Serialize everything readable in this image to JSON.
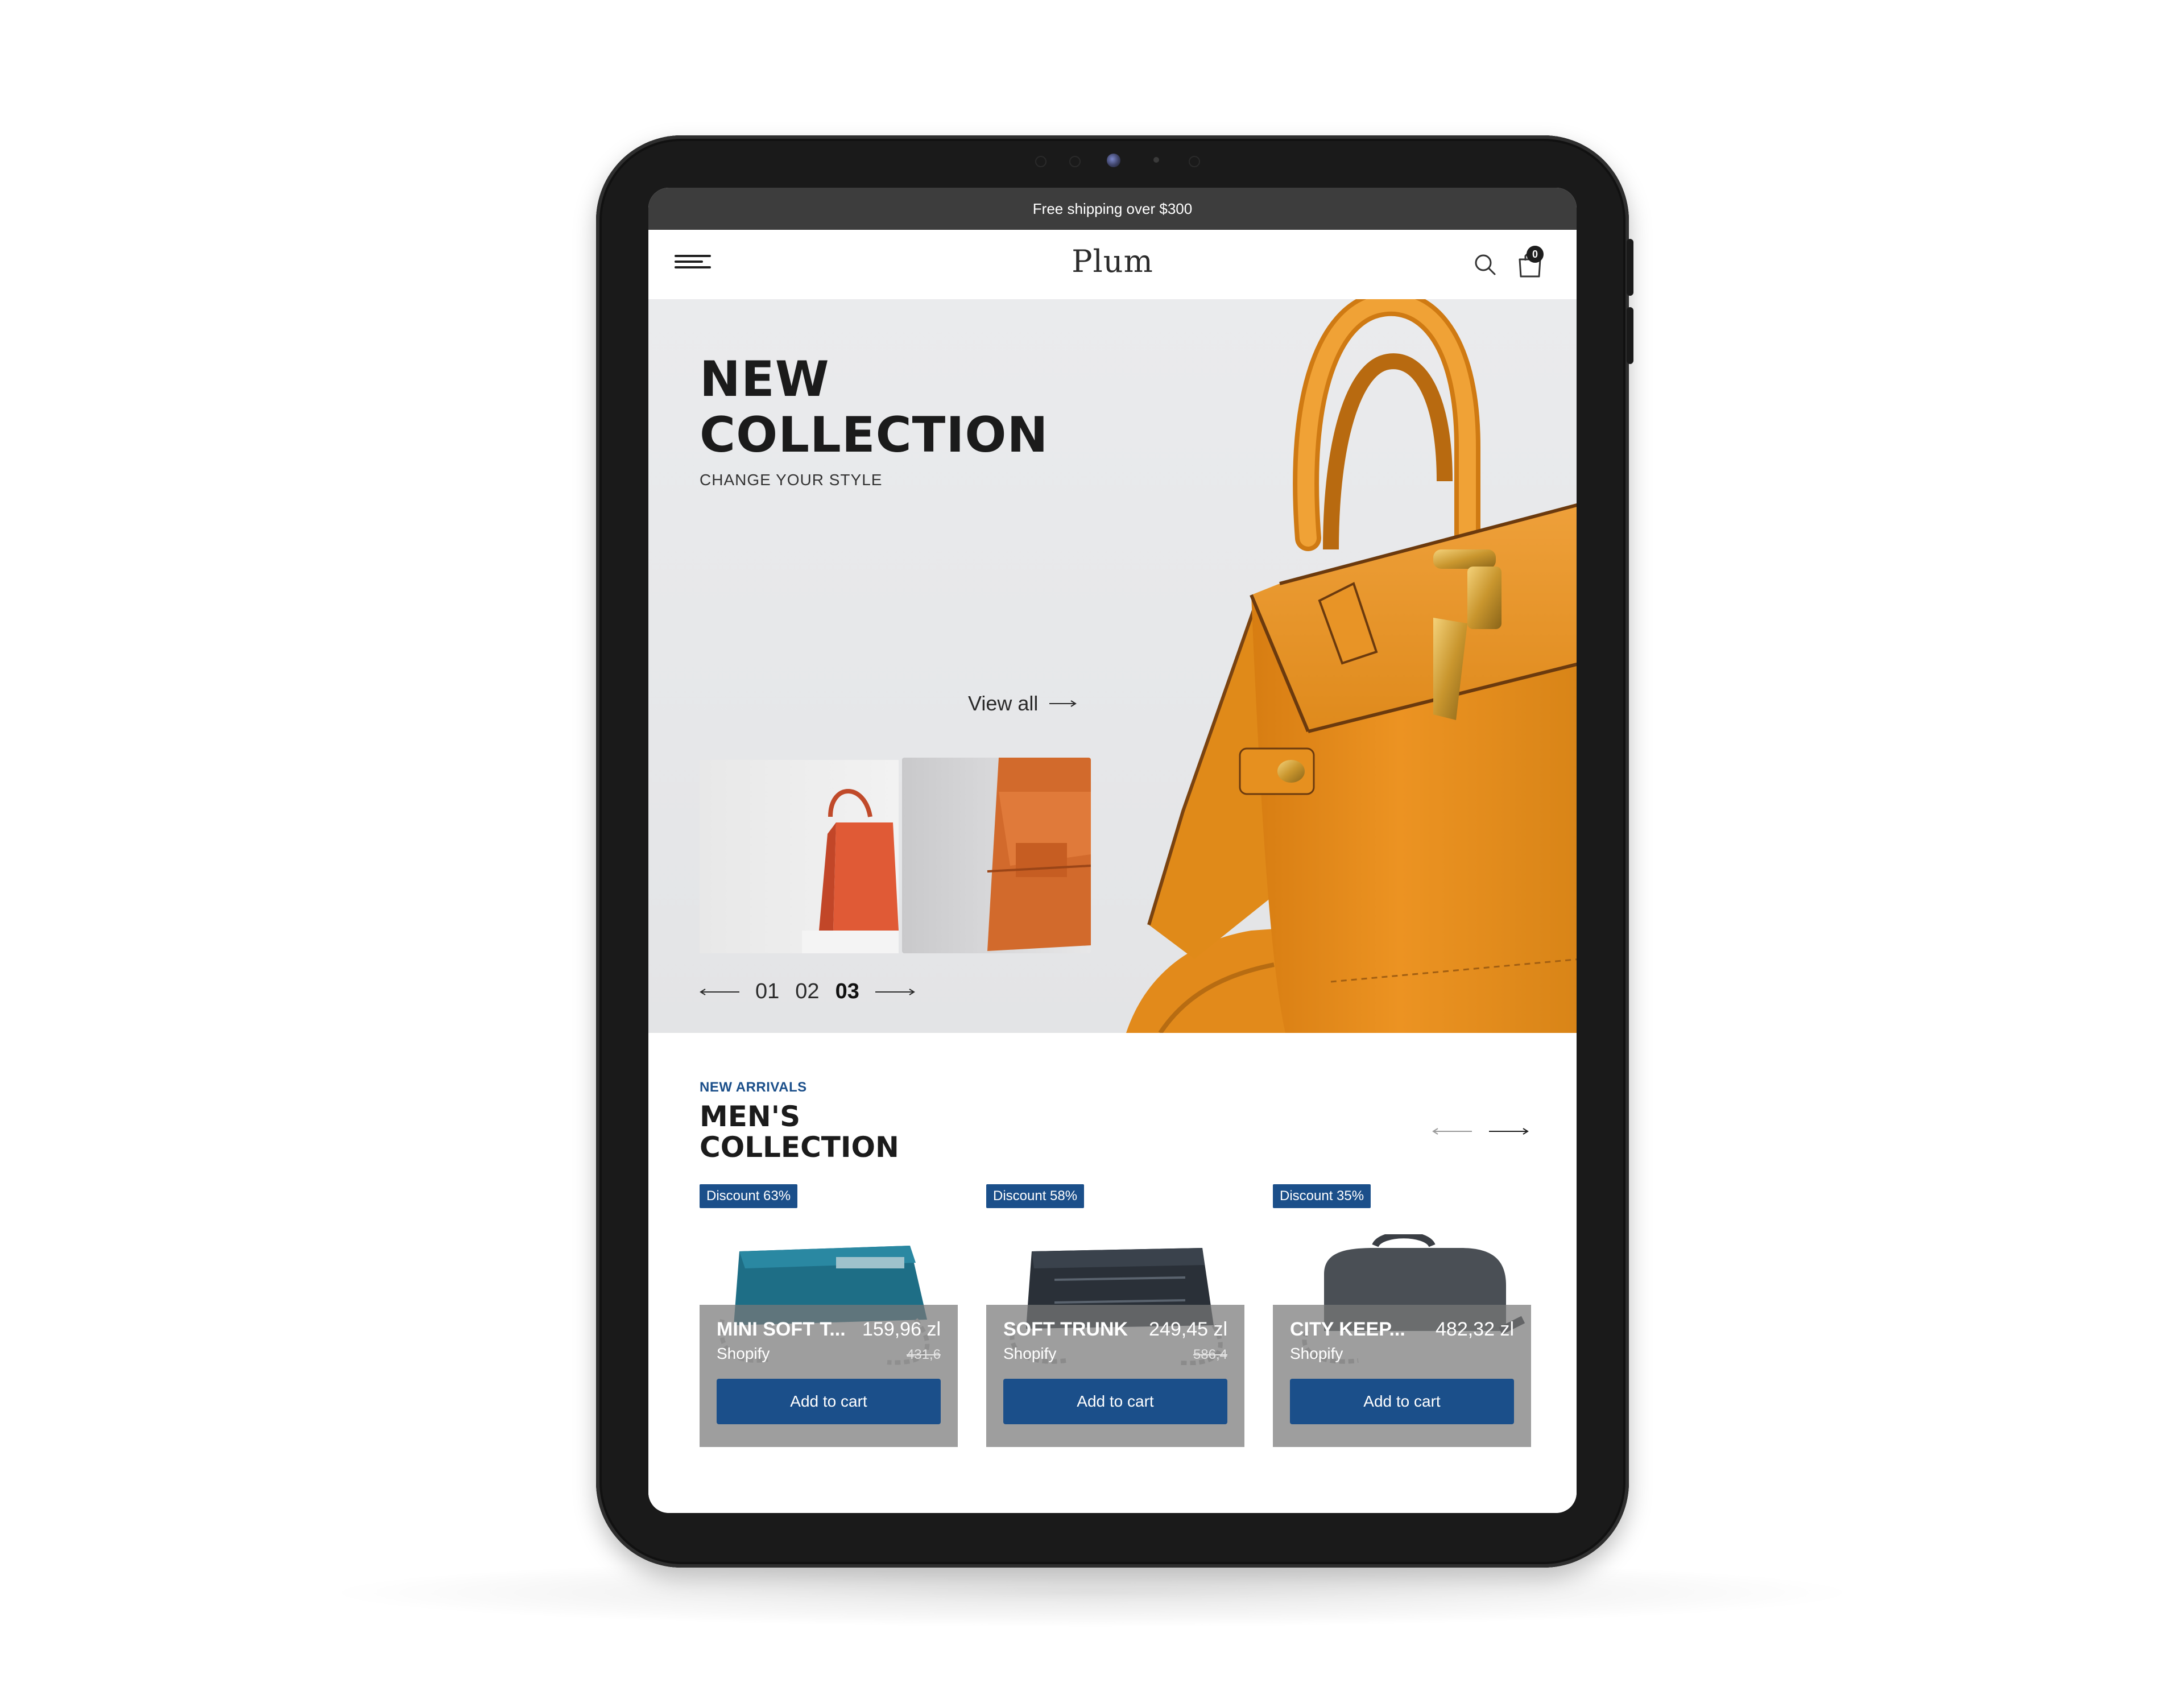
{
  "announcement": "Free shipping over $300",
  "header": {
    "logo": "Plum",
    "cart_count": "0",
    "icons": [
      "menu-icon",
      "search-icon",
      "shopping-bag-icon"
    ]
  },
  "hero": {
    "title_line1": "NEW",
    "title_line2": "COLLECTION",
    "subtitle": "CHANGE YOUR STYLE",
    "view_all": "View all",
    "slides": [
      "01",
      "02",
      "03"
    ],
    "active_slide": "03"
  },
  "section": {
    "eyebrow": "NEW ARRIVALS",
    "title_line1": "MEN'S",
    "title_line2": "COLLECTION",
    "progress": 0.49
  },
  "products": [
    {
      "badge": "Discount 63%",
      "name": "MINI SOFT T...",
      "price": "159,96 zl",
      "old_price": "431,6",
      "vendor": "Shopify",
      "button": "Add to cart",
      "color": "#1e6e86"
    },
    {
      "badge": "Discount 58%",
      "name": "SOFT TRUNK",
      "price": "249,45 zl",
      "old_price": "586,4",
      "vendor": "Shopify",
      "button": "Add to cart",
      "color": "#2a3038"
    },
    {
      "badge": "Discount 35%",
      "name": "CITY KEEP...",
      "price": "482,32 zl",
      "old_price": "",
      "vendor": "Shopify",
      "button": "Add to cart",
      "color": "#4a4f55"
    }
  ],
  "colors": {
    "accent": "#1b4f8a",
    "bag_orange": "#e8911e",
    "topbar": "#3d3d3d"
  }
}
